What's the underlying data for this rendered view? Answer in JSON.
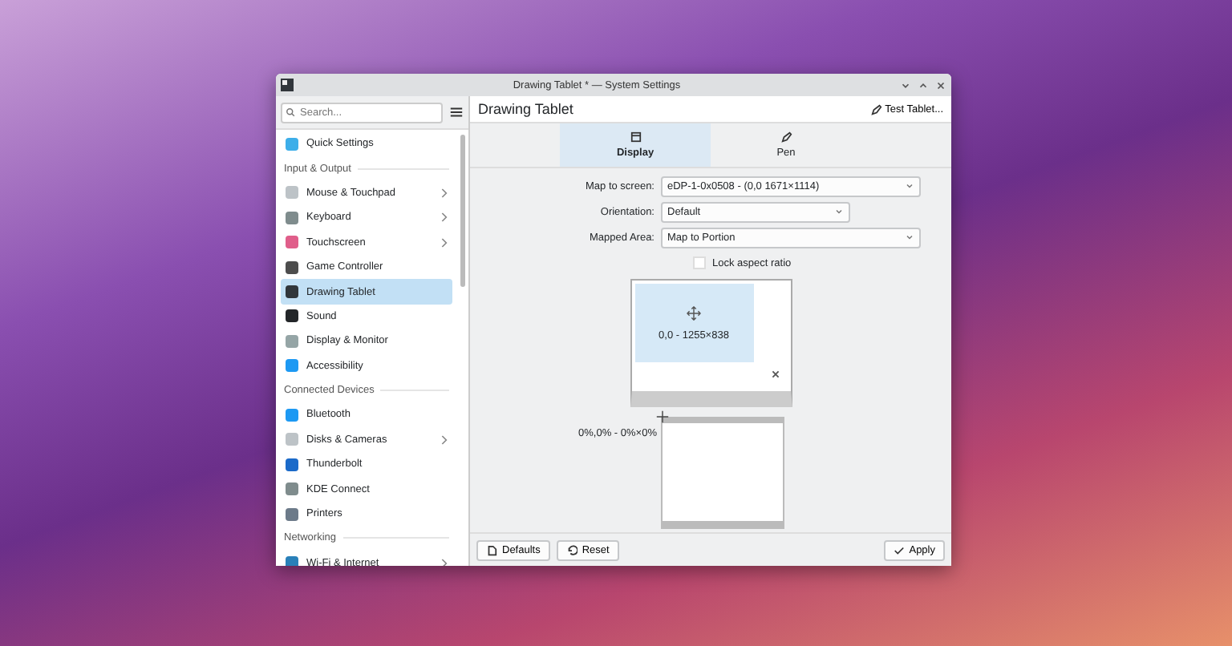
{
  "window": {
    "title": "Drawing Tablet * — System Settings"
  },
  "sidebar": {
    "search": {
      "placeholder": "Search..."
    },
    "items": [
      {
        "kind": "item",
        "label": "Quick Settings",
        "color": "#3daee9",
        "arrow": false,
        "selected": false
      },
      {
        "kind": "heading",
        "label": "Input & Output"
      },
      {
        "kind": "item",
        "label": "Mouse & Touchpad",
        "color": "#bdc3c7",
        "arrow": true,
        "selected": false
      },
      {
        "kind": "item",
        "label": "Keyboard",
        "color": "#7f8c8d",
        "arrow": true,
        "selected": false
      },
      {
        "kind": "item",
        "label": "Touchscreen",
        "color": "#e05e8a",
        "arrow": true,
        "selected": false
      },
      {
        "kind": "item",
        "label": "Game Controller",
        "color": "#4d4d4d",
        "arrow": false,
        "selected": false
      },
      {
        "kind": "item",
        "label": "Drawing Tablet",
        "color": "#31363b",
        "arrow": false,
        "selected": true
      },
      {
        "kind": "item",
        "label": "Sound",
        "color": "#232629",
        "arrow": false,
        "selected": false
      },
      {
        "kind": "item",
        "label": "Display & Monitor",
        "color": "#95a5a6",
        "arrow": false,
        "selected": false
      },
      {
        "kind": "item",
        "label": "Accessibility",
        "color": "#1d99f3",
        "arrow": false,
        "selected": false
      },
      {
        "kind": "heading",
        "label": "Connected Devices"
      },
      {
        "kind": "item",
        "label": "Bluetooth",
        "color": "#1d99f3",
        "arrow": false,
        "selected": false
      },
      {
        "kind": "item",
        "label": "Disks & Cameras",
        "color": "#bdc3c7",
        "arrow": true,
        "selected": false
      },
      {
        "kind": "item",
        "label": "Thunderbolt",
        "color": "#1b6ac9",
        "arrow": false,
        "selected": false
      },
      {
        "kind": "item",
        "label": "KDE Connect",
        "color": "#7f8c8d",
        "arrow": false,
        "selected": false
      },
      {
        "kind": "item",
        "label": "Printers",
        "color": "#6c7a89",
        "arrow": false,
        "selected": false
      },
      {
        "kind": "heading",
        "label": "Networking"
      },
      {
        "kind": "item",
        "label": "Wi-Fi & Internet",
        "color": "#2980b9",
        "arrow": true,
        "selected": false
      }
    ]
  },
  "main": {
    "title": "Drawing Tablet",
    "test_button": "Test Tablet...",
    "tabs": [
      {
        "label": "Display",
        "selected": true
      },
      {
        "label": "Pen",
        "selected": false
      }
    ],
    "fields": [
      {
        "label": "Map to screen:",
        "value": "eDP-1-0x0508 - (0,0 1671×1114)"
      },
      {
        "label": "Orientation:",
        "value": "Default"
      },
      {
        "label": "Mapped Area:",
        "value": "Map to Portion"
      }
    ],
    "lock_aspect_ratio": {
      "label": "Lock aspect ratio",
      "checked": false
    },
    "screen_area_label": "0,0 - 1255×838",
    "tablet_area_label": "0%,0% - 0%×0%"
  },
  "footer": {
    "defaults": "Defaults",
    "reset": "Reset",
    "apply": "Apply"
  }
}
